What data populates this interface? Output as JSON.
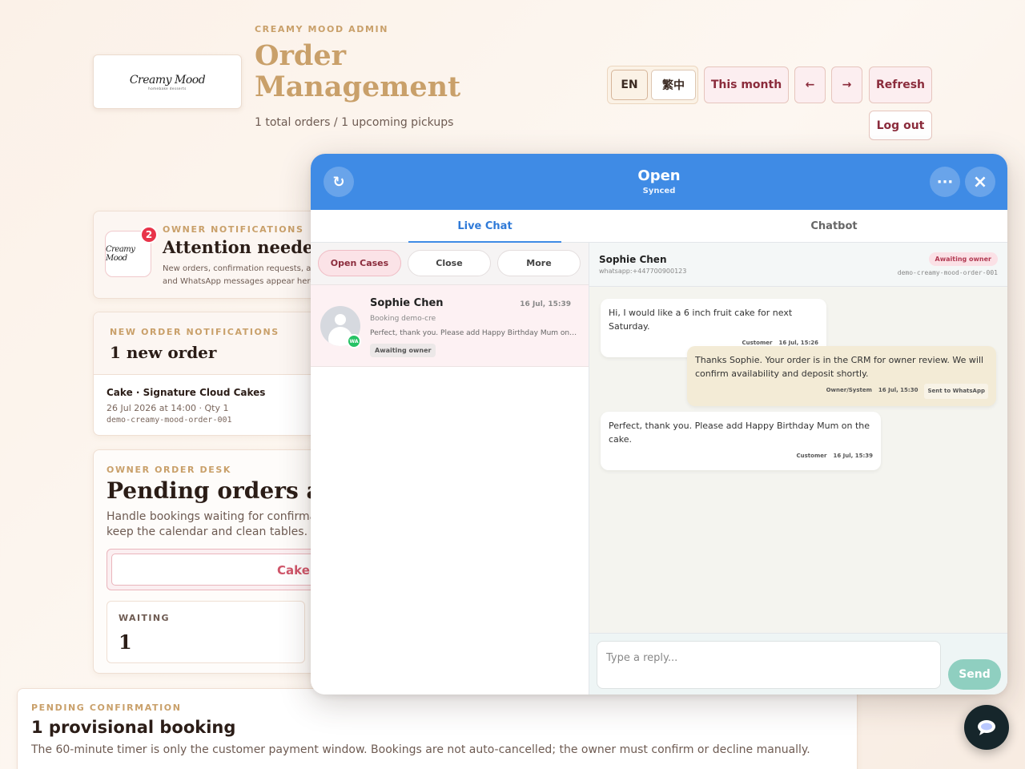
{
  "page": {
    "eyebrow": "CREAMY MOOD ADMIN",
    "title": "Order Management",
    "subtitle": "1 total orders / 1 upcoming pickups",
    "logo_text": "Creamy Mood",
    "logo_sub": "homebake desserts"
  },
  "toolbar": {
    "lang_en": "EN",
    "lang_zh": "繁中",
    "range": "This month",
    "prev": "←",
    "next": "→",
    "refresh": "Refresh",
    "logout": "Log out"
  },
  "owner_notifications": {
    "eyebrow": "OWNER NOTIFICATIONS",
    "badge": "2",
    "title": "Attention needed",
    "text": "New orders, confirmation requests, amendments, reviews and WhatsApp messages appear here."
  },
  "new_orders": {
    "eyebrow": "NEW ORDER NOTIFICATIONS",
    "title": "1 new order",
    "item": {
      "title": "Cake · Signature Cloud Cakes",
      "meta": "26 Jul 2026 at 14:00 · Qty 1",
      "id": "demo-creamy-mood-order-001"
    }
  },
  "desk": {
    "eyebrow": "OWNER ORDER DESK",
    "title": "Pending orders and bookings",
    "subtitle": "Handle bookings waiting for confirmation, then keep the calendar and clean tables.",
    "tab": "Cake Orders",
    "waiting_label": "WAITING",
    "waiting_value": "1"
  },
  "pending": {
    "eyebrow": "PENDING CONFIRMATION",
    "title": "1 provisional booking",
    "text": "The 60-minute timer is only the customer payment window. Bookings are not auto-cancelled; the owner must confirm or decline manually."
  },
  "chat": {
    "status": "Open",
    "sync": "Synced",
    "refresh_icon": "↻",
    "more_icon": "···",
    "close_icon": "×",
    "tabs": [
      "Live Chat",
      "Chatbot"
    ],
    "filters": [
      "Open Cases",
      "Close",
      "More"
    ],
    "conversation": {
      "name": "Sophie Chen",
      "time": "16 Jul, 15:39",
      "ref": "Booking demo-cre",
      "preview": "Perfect, thank you. Please add Happy Birthday Mum on the cake.",
      "status": "Awaiting owner",
      "channel": "WA"
    },
    "thread": {
      "name": "Sophie Chen",
      "contact": "whatsapp:+447700900123",
      "status": "Awaiting owner",
      "order_id": "demo-creamy-mood-order-001"
    },
    "messages": [
      {
        "text": "Hi, I would like a 6 inch fruit cake for next Saturday.",
        "author": "Customer",
        "time": "16 Jul, 15:26"
      },
      {
        "text": "Thanks Sophie. Your order is in the CRM for owner review. We will confirm availability and deposit shortly.",
        "author": "Owner/System",
        "time": "16 Jul, 15:30",
        "tag": "Sent to WhatsApp"
      },
      {
        "text": "Perfect, thank you. Please add Happy Birthday Mum on the cake.",
        "author": "Customer",
        "time": "16 Jul, 15:39"
      }
    ],
    "composer_placeholder": "Type a reply...",
    "send": "Send"
  },
  "colors": {
    "accent_gold": "#c9a06a",
    "brand_red": "#8b2c3c",
    "chat_blue": "#3f8be5",
    "send_teal": "#8fcfc0",
    "badge_red": "#e8344a"
  }
}
